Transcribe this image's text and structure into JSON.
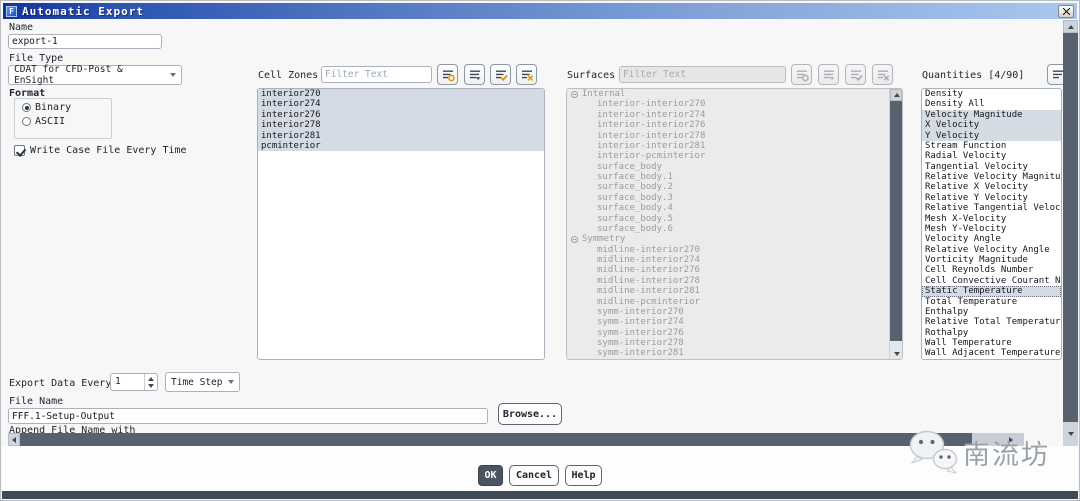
{
  "window": {
    "title": "Automatic Export",
    "icon_letter": "F"
  },
  "name_field": {
    "label": "Name",
    "value": "export-1"
  },
  "file_type": {
    "label": "File Type",
    "value": "CDAT for CFD-Post & EnSight"
  },
  "format": {
    "label": "Format",
    "options": [
      "Binary",
      "ASCII"
    ],
    "selected": "Binary"
  },
  "write_case": {
    "label": "Write Case File Every Time",
    "checked": true
  },
  "cell_zones": {
    "label": "Cell Zones",
    "filter_placeholder": "Filter Text",
    "toolbar_icons": [
      "filter-match-icon",
      "filter-options-icon",
      "select-all-icon",
      "deselect-all-icon"
    ],
    "items": [
      "interior270",
      "interior274",
      "interior276",
      "interior278",
      "interior281",
      "pcminterior"
    ],
    "all_selected": true
  },
  "surfaces": {
    "label": "Surfaces",
    "filter_placeholder": "Filter Text",
    "disabled": true,
    "toolbar_icons": [
      "filter-match-icon",
      "filter-options-icon",
      "select-all-icon",
      "deselect-all-icon"
    ],
    "groups": [
      {
        "name": "Internal",
        "children": [
          "interior-interior270",
          "interior-interior274",
          "interior-interior276",
          "interior-interior278",
          "interior-interior281",
          "interior-pcminterior",
          "surface_body",
          "surface_body.1",
          "surface_body.2",
          "surface_body.3",
          "surface_body.4",
          "surface_body.5",
          "surface_body.6"
        ]
      },
      {
        "name": "Symmetry",
        "children": [
          "midline-interior270",
          "midline-interior274",
          "midline-interior276",
          "midline-interior278",
          "midline-interior281",
          "midline-pcminterior",
          "symm-interior270",
          "symm-interior274",
          "symm-interior276",
          "symm-interior278",
          "symm-interior281"
        ]
      }
    ]
  },
  "quantities": {
    "label": "Quantities [4/90]",
    "toolbar_icons": [
      "filter-options-icon"
    ],
    "items": [
      {
        "label": "Density",
        "selected": false,
        "focused": false
      },
      {
        "label": "Density All",
        "selected": false,
        "focused": false
      },
      {
        "label": "Velocity Magnitude",
        "selected": true,
        "focused": false
      },
      {
        "label": "X Velocity",
        "selected": true,
        "focused": false
      },
      {
        "label": "Y Velocity",
        "selected": true,
        "focused": false
      },
      {
        "label": "Stream Function",
        "selected": false,
        "focused": false
      },
      {
        "label": "Radial Velocity",
        "selected": false,
        "focused": false
      },
      {
        "label": "Tangential Velocity",
        "selected": false,
        "focused": false
      },
      {
        "label": "Relative Velocity Magnitude",
        "selected": false,
        "focused": false
      },
      {
        "label": "Relative X Velocity",
        "selected": false,
        "focused": false
      },
      {
        "label": "Relative Y Velocity",
        "selected": false,
        "focused": false
      },
      {
        "label": "Relative Tangential Velocity",
        "selected": false,
        "focused": false
      },
      {
        "label": "Mesh X-Velocity",
        "selected": false,
        "focused": false
      },
      {
        "label": "Mesh Y-Velocity",
        "selected": false,
        "focused": false
      },
      {
        "label": "Velocity Angle",
        "selected": false,
        "focused": false
      },
      {
        "label": "Relative Velocity Angle",
        "selected": false,
        "focused": false
      },
      {
        "label": "Vorticity Magnitude",
        "selected": false,
        "focused": false
      },
      {
        "label": "Cell Reynolds Number",
        "selected": false,
        "focused": false
      },
      {
        "label": "Cell Convective Courant Number",
        "selected": false,
        "focused": false
      },
      {
        "label": "Static Temperature",
        "selected": true,
        "focused": true
      },
      {
        "label": "Total Temperature",
        "selected": false,
        "focused": false
      },
      {
        "label": "Enthalpy",
        "selected": false,
        "focused": false
      },
      {
        "label": "Relative Total Temperature",
        "selected": false,
        "focused": false
      },
      {
        "label": "Rothalpy",
        "selected": false,
        "focused": false
      },
      {
        "label": "Wall Temperature",
        "selected": false,
        "focused": false
      },
      {
        "label": "Wall Adjacent Temperature",
        "selected": false,
        "focused": false
      }
    ]
  },
  "export_every": {
    "label": "Export Data Every",
    "value": "1",
    "unit": "Time Step"
  },
  "file_name": {
    "label": "File Name",
    "value": "FFF.1-Setup-Output",
    "browse_label": "Browse...",
    "append_label": "Append File Name with"
  },
  "actions": {
    "ok": "OK",
    "cancel": "Cancel",
    "help": "Help"
  },
  "watermark": {
    "text": "南流坊",
    "icon": "wechat-icon"
  },
  "colors": {
    "titlebar_left": "#14319b",
    "titlebar_right": "#a9c7ee",
    "selection": "#d4dbe5",
    "accent_orange": "#dd9900",
    "ok_button": "#4a5462",
    "scrollbar_thumb": "#57616f"
  }
}
